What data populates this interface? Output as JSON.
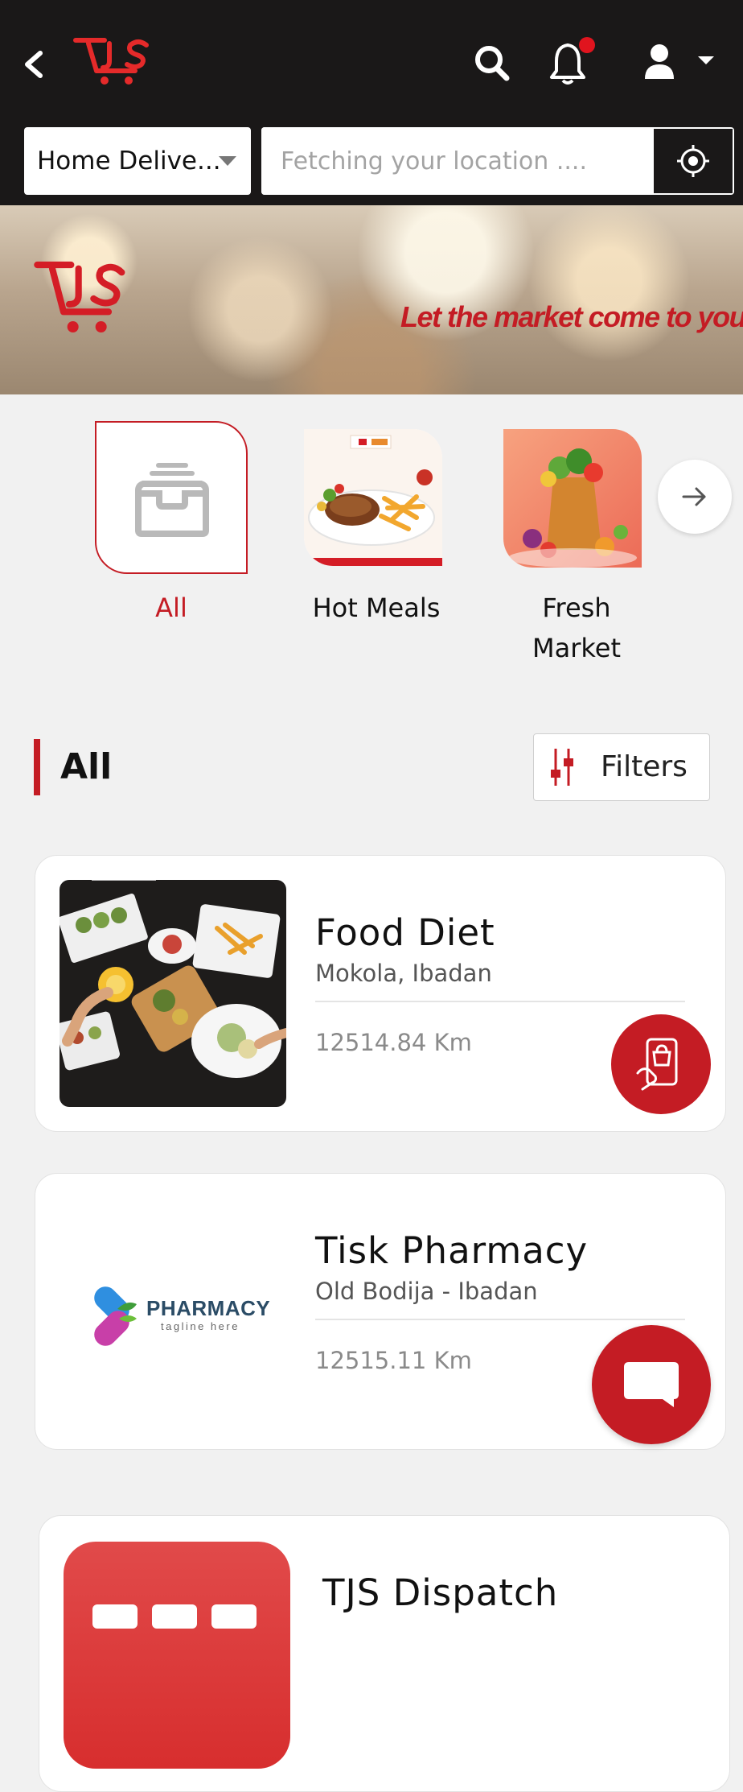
{
  "header": {
    "delivery_mode": "Home Delive...",
    "location_placeholder": "Fetching your location ...."
  },
  "banner": {
    "tagline": "Let the market come to you..."
  },
  "categories": [
    {
      "label": "All",
      "selected": true,
      "icon": "inbox-icon"
    },
    {
      "label": "Hot Meals",
      "selected": false
    },
    {
      "label": "Fresh Market",
      "selected": false
    }
  ],
  "section": {
    "title": "All",
    "filters_label": "Filters"
  },
  "stores": [
    {
      "name": "Food Diet",
      "location": "Mokola, Ibadan",
      "distance": "12514.84 Km"
    },
    {
      "name": "Tisk Pharmacy",
      "location": "Old Bodija - Ibadan",
      "distance": "12515.11 Km",
      "logo_text": "PHARMACY",
      "logo_tagline": "tagline here"
    },
    {
      "name": "TJS Dispatch"
    }
  ],
  "colors": {
    "accent": "#c41c24",
    "header_bg": "#1a1818",
    "page_bg": "#f1f1f1"
  }
}
